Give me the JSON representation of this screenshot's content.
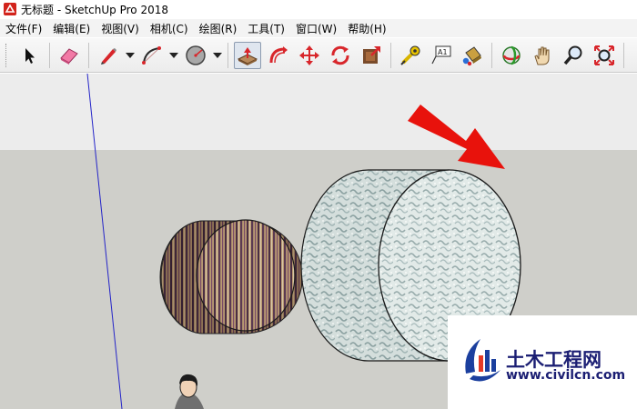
{
  "window": {
    "title": "无标题 - SketchUp Pro 2018",
    "icon": "sketchup-logo-icon"
  },
  "menu": {
    "items": [
      {
        "label": "文件(F)"
      },
      {
        "label": "编辑(E)"
      },
      {
        "label": "视图(V)"
      },
      {
        "label": "相机(C)"
      },
      {
        "label": "绘图(R)"
      },
      {
        "label": "工具(T)"
      },
      {
        "label": "窗口(W)"
      },
      {
        "label": "帮助(H)"
      }
    ]
  },
  "toolbar": {
    "tools": [
      "select-arrow-icon",
      "eraser-icon",
      "pencil-line-icon",
      "arc-icon",
      "circle-icon",
      "push-pull-icon",
      "follow-me-icon",
      "move-icon",
      "rotate-icon",
      "offset-icon",
      "tape-measure-icon",
      "text-label-icon",
      "paint-bucket-icon",
      "orbit-icon",
      "pan-hand-icon",
      "zoom-icon",
      "zoom-extents-icon"
    ],
    "text_tool_label": "A1",
    "active_tool": "push-pull-icon"
  },
  "scene": {
    "sky_color": "#ececec",
    "ground_color": "#cfcfca",
    "axis_color": "#2424c8",
    "arrow_color": "#e8120c"
  },
  "watermark": {
    "text": "土木工程网",
    "url": "www.civilcn.com"
  }
}
